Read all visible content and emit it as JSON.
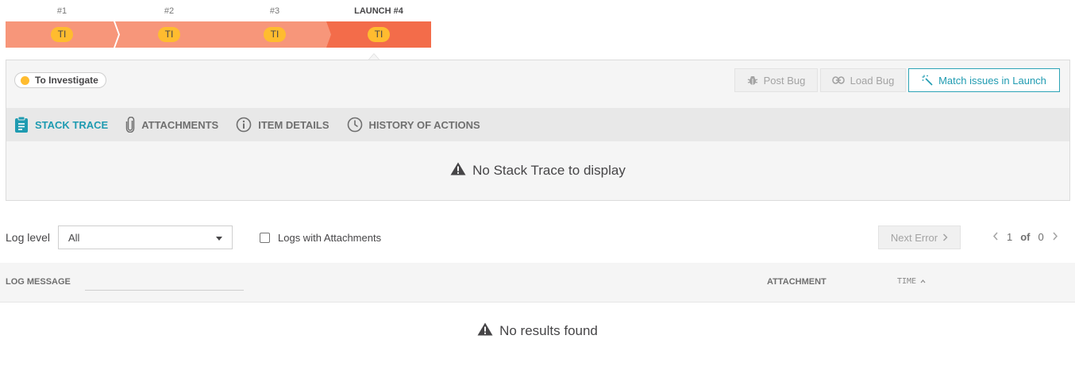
{
  "history": {
    "items": [
      {
        "label": "#1",
        "badge": "TI",
        "active": false
      },
      {
        "label": "#2",
        "badge": "TI",
        "active": false
      },
      {
        "label": "#3",
        "badge": "TI",
        "active": false
      },
      {
        "label": "LAUNCH #4",
        "badge": "TI",
        "active": true
      }
    ],
    "colors": {
      "normal": "#f7967a",
      "active": "#f36c4a",
      "badge": "#ffbc2f"
    }
  },
  "panel": {
    "defect_type": "To Investigate",
    "buttons": {
      "post_bug": "Post Bug",
      "load_bug": "Load Bug",
      "match_issues": "Match issues in Launch"
    },
    "tabs": [
      {
        "label": "STACK TRACE",
        "icon": "clipboard-icon",
        "active": true
      },
      {
        "label": "ATTACHMENTS",
        "icon": "paperclip-icon",
        "active": false
      },
      {
        "label": "ITEM DETAILS",
        "icon": "info-icon",
        "active": false
      },
      {
        "label": "HISTORY OF ACTIONS",
        "icon": "clock-icon",
        "active": false
      }
    ],
    "empty_message": "No Stack Trace to display"
  },
  "log_controls": {
    "log_level_label": "Log level",
    "log_level_value": "All",
    "logs_with_attachments": "Logs with Attachments",
    "next_error": "Next Error",
    "pager": {
      "current": "1",
      "of": "of",
      "total": "0"
    }
  },
  "log_table": {
    "columns": {
      "message": "LOG MESSAGE",
      "attachment": "ATTACHMENT",
      "time": "TIME"
    },
    "empty_message": "No results found"
  },
  "accent_color": "#1f9bb1"
}
